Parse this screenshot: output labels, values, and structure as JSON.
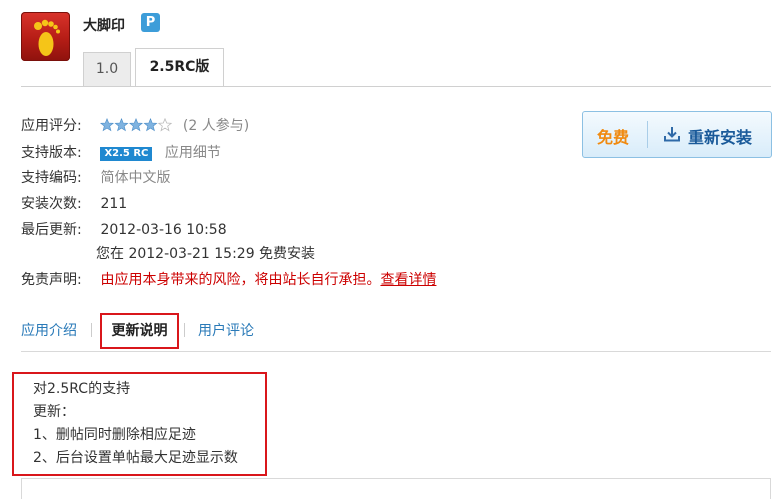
{
  "app": {
    "name": "大脚印",
    "badge": "P"
  },
  "version_tabs": [
    {
      "label": "1.0",
      "active": false
    },
    {
      "label": "2.5RC版",
      "active": true
    }
  ],
  "info": {
    "rating_label": "应用评分:",
    "rating_stars": 4,
    "rating_max": 5,
    "rating_count": "(2 人参与)",
    "version_label": "支持版本:",
    "version_badge": "X2.5 RC",
    "version_detail": "应用细节",
    "encoding_label": "支持编码:",
    "encoding_value": "简体中文版",
    "installs_label": "安装次数:",
    "installs_value": "211",
    "updated_label": "最后更新:",
    "updated_value": "2012-03-16 10:58",
    "installed_note": "您在 2012-03-21 15:29 免费安装",
    "disclaimer_label": "免责声明:",
    "disclaimer_text": "由应用本身带来的风险，将由站长自行承担。",
    "disclaimer_link": "查看详情"
  },
  "install_button": {
    "free": "免费",
    "action": "重新安装"
  },
  "content_tabs": [
    {
      "label": "应用介绍",
      "active": false
    },
    {
      "label": "更新说明",
      "active": true
    },
    {
      "label": "用户评论",
      "active": false
    }
  ],
  "notes": [
    "对2.5RC的支持",
    "更新：",
    "1、删帖同时删除相应足迹",
    "2、后台设置单帖最大足迹显示数"
  ],
  "colors": {
    "accent_red": "#d9161b",
    "link_blue": "#2a7ab8",
    "free_orange": "#f08a10",
    "badge_blue": "#1f88d0"
  }
}
